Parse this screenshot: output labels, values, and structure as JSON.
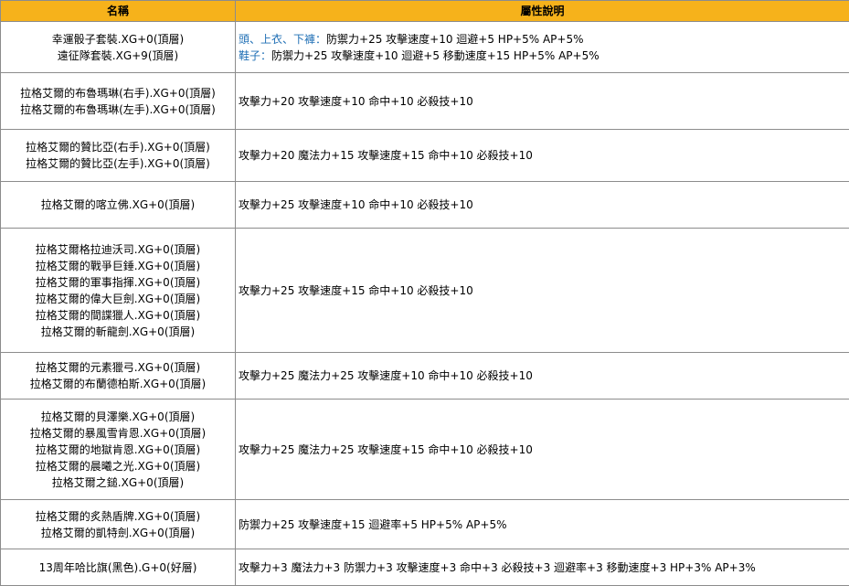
{
  "header": {
    "name_col": "名稱",
    "desc_col": "屬性說明"
  },
  "colors": {
    "header_bg": "#f6b21b",
    "border": "#8c8c8c",
    "highlight_text": "#1f6fb5"
  },
  "rows": [
    {
      "names": [
        "幸運骰子套裝.XG+0(頂層)",
        "遠征隊套裝.XG+9(頂層)"
      ],
      "desc": [
        {
          "label": "頭、上衣、下褲：",
          "text": "防禦力+25 攻擊速度+10 迴避+5 HP+5% AP+5%"
        },
        {
          "label": "鞋子：",
          "text": "防禦力+25 攻擊速度+10 迴避+5 移動速度+15 HP+5% AP+5%"
        }
      ]
    },
    {
      "names": [
        "拉格艾爾的布魯瑪琳(右手).XG+0(頂層)",
        "拉格艾爾的布魯瑪琳(左手).XG+0(頂層)"
      ],
      "desc": [
        {
          "label": "",
          "text": "攻擊力+20 攻擊速度+10 命中+10 必殺技+10"
        }
      ]
    },
    {
      "names": [
        "拉格艾爾的贊比亞(右手).XG+0(頂層)",
        "拉格艾爾的贊比亞(左手).XG+0(頂層)"
      ],
      "desc": [
        {
          "label": "",
          "text": "攻擊力+20 魔法力+15 攻擊速度+15 命中+10 必殺技+10"
        }
      ]
    },
    {
      "names": [
        "拉格艾爾的喀立佛.XG+0(頂層)"
      ],
      "desc": [
        {
          "label": "",
          "text": "攻擊力+25 攻擊速度+10 命中+10 必殺技+10"
        }
      ]
    },
    {
      "names": [
        "拉格艾爾格拉迪沃司.XG+0(頂層)",
        "拉格艾爾的戰爭巨錘.XG+0(頂層)",
        "拉格艾爾的軍事指揮.XG+0(頂層)",
        "拉格艾爾的偉大巨劍.XG+0(頂層)",
        "拉格艾爾的間諜獵人.XG+0(頂層)",
        "拉格艾爾的斬龍劍.XG+0(頂層)"
      ],
      "desc": [
        {
          "label": "",
          "text": "攻擊力+25 攻擊速度+15 命中+10 必殺技+10"
        }
      ]
    },
    {
      "names": [
        "拉格艾爾的元素獵弓.XG+0(頂層)",
        "拉格艾爾的布蘭德柏斯.XG+0(頂層)"
      ],
      "desc": [
        {
          "label": "",
          "text": "攻擊力+25 魔法力+25 攻擊速度+10 命中+10 必殺技+10"
        }
      ]
    },
    {
      "names": [
        "拉格艾爾的貝澤樂.XG+0(頂層)",
        "拉格艾爾的暴風雪肯恩.XG+0(頂層)",
        "拉格艾爾的地獄肯恩.XG+0(頂層)",
        "拉格艾爾的晨曦之光.XG+0(頂層)",
        "拉格艾爾之鎚.XG+0(頂層)"
      ],
      "desc": [
        {
          "label": "",
          "text": "攻擊力+25 魔法力+25 攻擊速度+15 命中+10 必殺技+10"
        }
      ]
    },
    {
      "names": [
        "拉格艾爾的炙熱盾牌.XG+0(頂層)",
        "拉格艾爾的凱特劍.XG+0(頂層)"
      ],
      "desc": [
        {
          "label": "",
          "text": "防禦力+25 攻擊速度+15 迴避率+5 HP+5% AP+5%"
        }
      ]
    },
    {
      "names": [
        "13周年哈比旗(黑色).G+0(好層)"
      ],
      "desc": [
        {
          "label": "",
          "text": "攻擊力+3 魔法力+3 防禦力+3 攻擊速度+3 命中+3 必殺技+3 迴避率+3 移動速度+3  HP+3% AP+3%"
        }
      ]
    }
  ]
}
